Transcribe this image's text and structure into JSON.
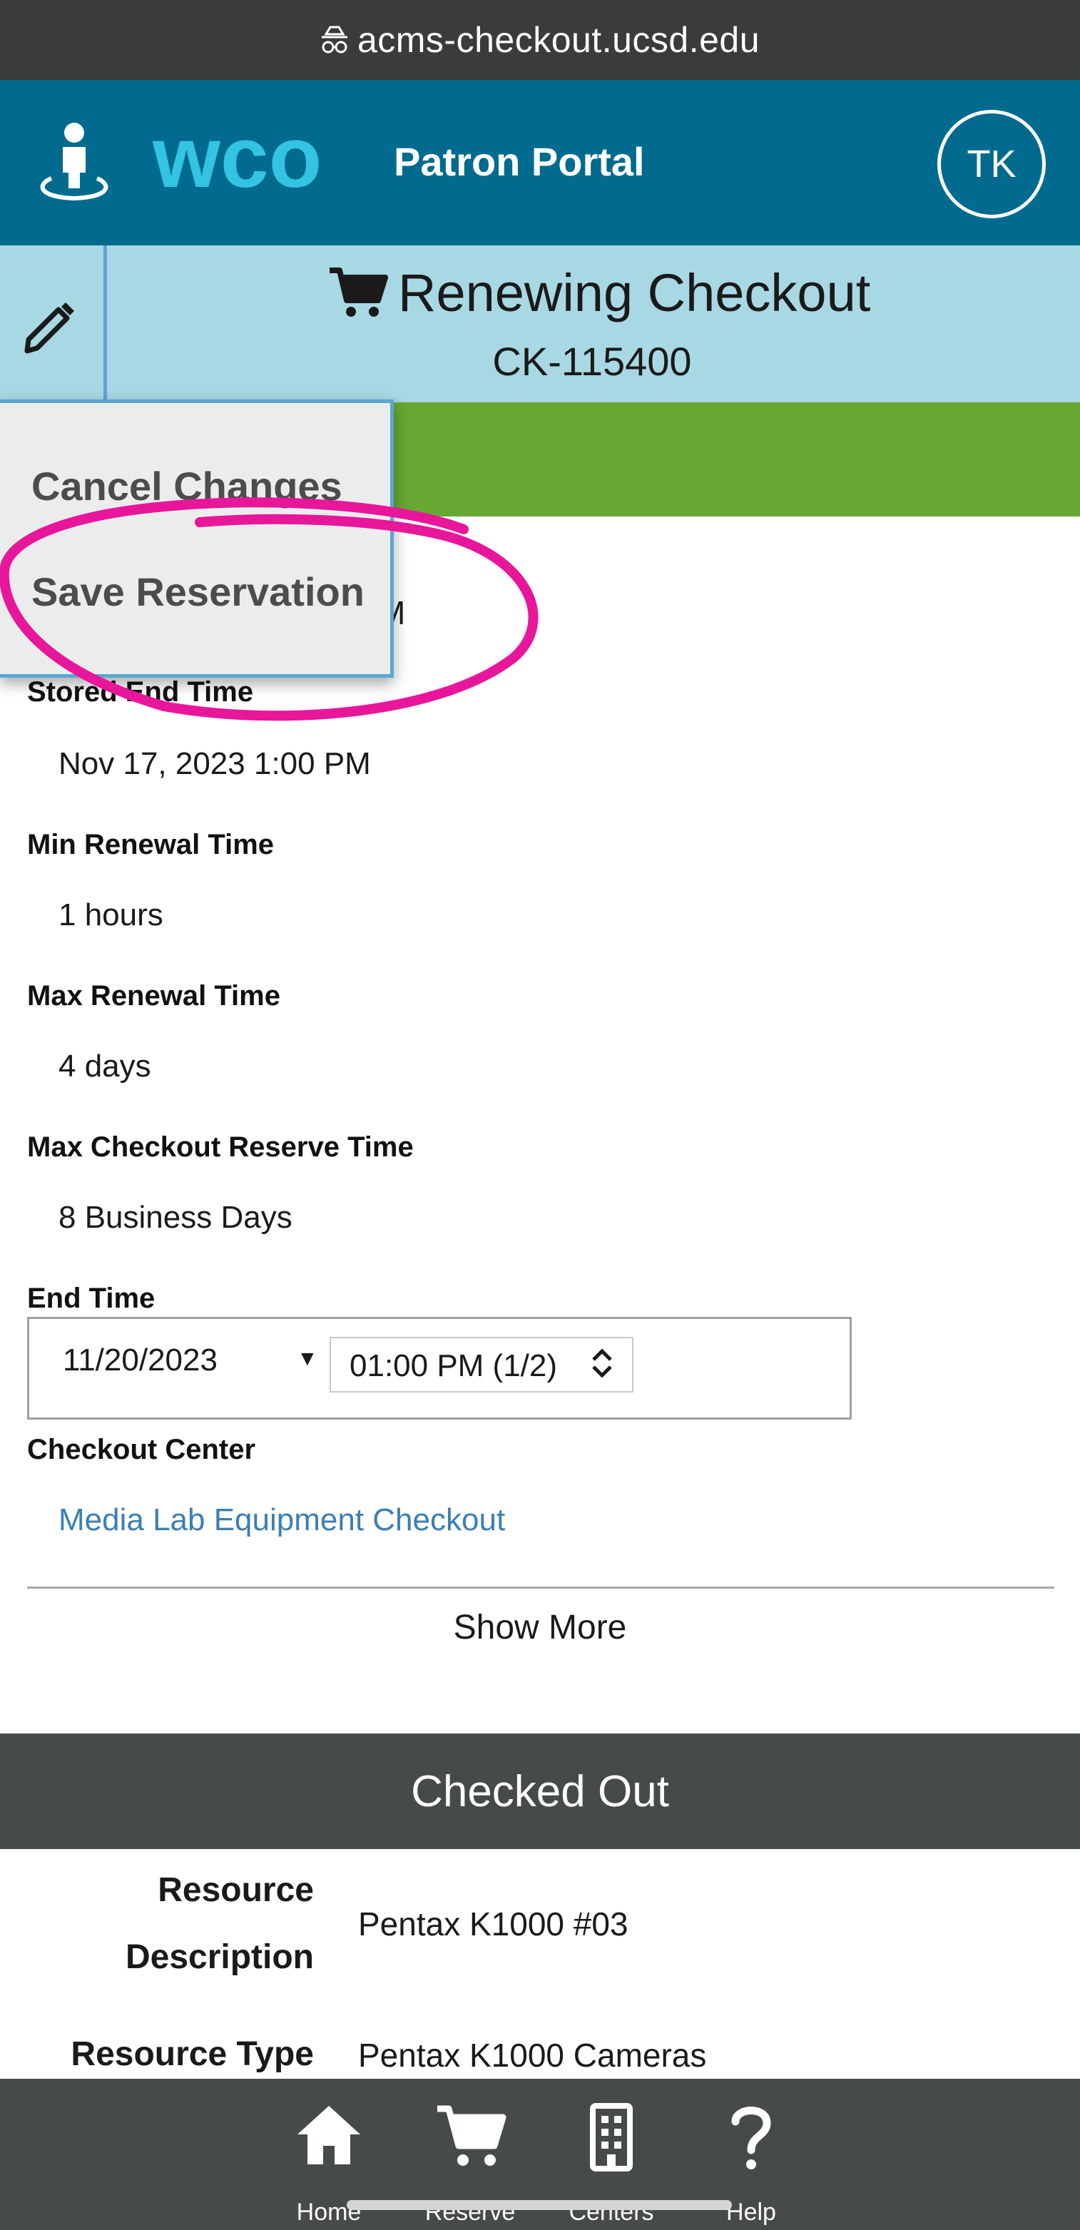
{
  "browser": {
    "url": "acms-checkout.ucsd.edu"
  },
  "header": {
    "logo_text": "wco",
    "portal_title": "Patron Portal",
    "avatar_initials": "TK"
  },
  "subheader": {
    "title": "Renewing Checkout",
    "checkout_id": "CK-115400"
  },
  "menu": {
    "items": [
      "Cancel Changes",
      "Save Reservation"
    ]
  },
  "details": {
    "partially_hidden_value": "M",
    "stored_end_time_label": "Stored End Time",
    "stored_end_time": "Nov 17, 2023 1:00 PM",
    "min_renewal_label": "Min Renewal Time",
    "min_renewal": "1 hours",
    "max_renewal_label": "Max Renewal Time",
    "max_renewal": "4 days",
    "max_checkout_label": "Max Checkout Reserve Time",
    "max_checkout": "8 Business Days",
    "end_time_label": "End Time",
    "end_date": "11/20/2023",
    "end_time": "01:00 PM (1/2)",
    "checkout_center_label": "Checkout Center",
    "checkout_center": "Media Lab Equipment Checkout",
    "show_more": "Show More"
  },
  "checked_out": {
    "title": "Checked Out",
    "resource_description_label_1": "Resource",
    "resource_description_label_2": "Description",
    "resource_description": "Pentax K1000 #03",
    "resource_type_label": "Resource Type",
    "resource_type": "Pentax K1000 Cameras"
  },
  "nav": {
    "items": [
      "Home",
      "Reserve",
      "Centers",
      "Help"
    ]
  },
  "colors": {
    "header_blue": "#006b8e",
    "logo_cyan": "#32c4e2",
    "subheader_light_blue": "#a8d8e3",
    "green_bar": "#67a832",
    "annotation_pink": "#e8169b",
    "link_blue": "#3b7fb5",
    "dark_gray": "#464a4a"
  }
}
